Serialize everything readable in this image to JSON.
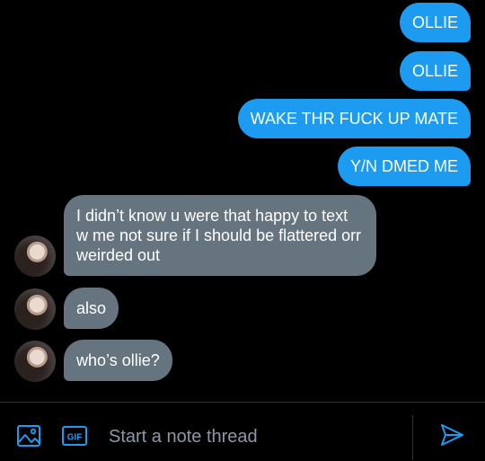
{
  "messages_out": [
    {
      "text": "OLLIE"
    },
    {
      "text": "OLLIE"
    },
    {
      "text": "WAKE THR FUCK UP MATE"
    },
    {
      "text": "Y/N DMED ME"
    }
  ],
  "messages_in": [
    {
      "text": "I didn’t know u were that happy to text w me not sure if I should be flattered orr weirded out"
    },
    {
      "text": "also"
    },
    {
      "text": "who’s ollie?"
    }
  ],
  "composer": {
    "placeholder": "Start a note thread",
    "gif_label": "GIF",
    "icons": [
      "image-icon",
      "gif-icon",
      "send-icon"
    ]
  },
  "colors": {
    "outgoing_bubble": "#1d9bf0",
    "incoming_bubble": "#66747f",
    "background": "#000000"
  }
}
